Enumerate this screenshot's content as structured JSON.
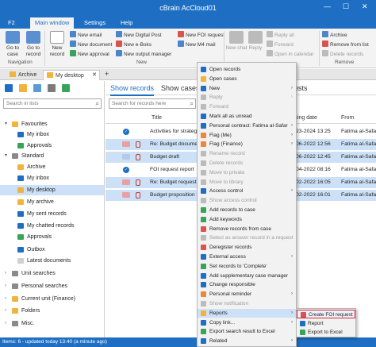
{
  "window": {
    "title": "cBrain AcCloud01",
    "minimize": "—",
    "maximize": "☐",
    "close": "✕"
  },
  "ribbon_tabs": [
    {
      "label": "F2"
    },
    {
      "label": "Main window"
    },
    {
      "label": "Settings"
    },
    {
      "label": "Help"
    }
  ],
  "ribbon": {
    "go_to_case": "Go to case",
    "go_to_record": "Go to record",
    "new_record": "New record",
    "navigation_group": "Navigation",
    "new_email": "New email",
    "new_document": "New document",
    "new_approval": "New approval",
    "new_digital_post": "New Digital Post",
    "new_eboks": "New e-Boks",
    "new_output_manager": "New output manager",
    "new_foi_request": "New FOI request",
    "new_m4_mail": "New M4 mail",
    "new_group": "New",
    "new_chat": "New chat",
    "reply": "Reply",
    "reply_all": "Reply all",
    "forward": "Forward",
    "open_in_calendar": "Open in calendar",
    "archive": "Archive",
    "remove_from_list": "Remove from list",
    "delete_records": "Delete records",
    "remove_group": "Remove"
  },
  "doc_tabs": [
    {
      "label": "Archive"
    },
    {
      "label": "My desktop"
    }
  ],
  "left": {
    "search_placeholder": "Search in lists",
    "tree": [
      {
        "label": "Favourites"
      },
      {
        "label": "My inbox"
      },
      {
        "label": "Approvals"
      },
      {
        "label": "Standard"
      },
      {
        "label": "Archive"
      },
      {
        "label": "My inbox"
      },
      {
        "label": "My desktop"
      },
      {
        "label": "My archive"
      },
      {
        "label": "My sent records"
      },
      {
        "label": "My chatted records"
      },
      {
        "label": "Approvals"
      },
      {
        "label": "Outbox"
      },
      {
        "label": "Latest documents"
      },
      {
        "label": "Unit searches"
      },
      {
        "label": "Personal searches"
      },
      {
        "label": "Current unit (Finance)"
      },
      {
        "label": "Folders"
      },
      {
        "label": "Misc."
      }
    ]
  },
  "main": {
    "view_tabs": [
      {
        "label": "Show records"
      },
      {
        "label": "Show cases"
      },
      {
        "label": "ests"
      }
    ],
    "search_placeholder": "Search for records here",
    "columns": {
      "title": "Title",
      "date": "ting date",
      "from": "From"
    },
    "rows": [
      {
        "title": "Activities for strategy",
        "date": "23-2024 13:25",
        "from": "Fatima al-Safar"
      },
      {
        "title": "Re: Budget document",
        "date": "06-2022 12:56",
        "from": "Fatima al-Safar"
      },
      {
        "title": "Budget draft",
        "date": "06-2022 12:45",
        "from": "Fatima al-Safar"
      },
      {
        "title": "FOI request report",
        "date": "04-2022 08:16",
        "from": "Fatima al-Safar"
      },
      {
        "title": "Re: Budget request",
        "date": "02-2022 16:05",
        "from": "Fatima al-Safar"
      },
      {
        "title": "Budget proposition fo",
        "date": "02-2022 16:01",
        "from": "Fatima al-Safar"
      }
    ]
  },
  "context_menu": [
    {
      "label": "Open records",
      "sub": ""
    },
    {
      "label": "Open cases",
      "sub": ""
    },
    {
      "label": "New",
      "sub": "›"
    },
    {
      "label": "Reply",
      "sub": "›"
    },
    {
      "label": "Forward",
      "sub": ""
    },
    {
      "label": "Mark all as unread",
      "sub": ""
    },
    {
      "label": "Personal contract: Fatima al-Safar",
      "sub": "›"
    },
    {
      "label": "Flag (Me)",
      "sub": "›"
    },
    {
      "label": "Flag (Finance)",
      "sub": "›"
    },
    {
      "label": "Rename record",
      "sub": ""
    },
    {
      "label": "Delete records",
      "sub": ""
    },
    {
      "label": "Move to private",
      "sub": ""
    },
    {
      "label": "Move to library",
      "sub": ""
    },
    {
      "label": "Access control",
      "sub": "›"
    },
    {
      "label": "Show access control",
      "sub": ""
    },
    {
      "label": "Add records to case",
      "sub": ""
    },
    {
      "label": "Add keywords",
      "sub": ""
    },
    {
      "label": "Remove records from case",
      "sub": ""
    },
    {
      "label": "Select as answer record in a request",
      "sub": ""
    },
    {
      "label": "Deregister records",
      "sub": ""
    },
    {
      "label": "External access",
      "sub": "›"
    },
    {
      "label": "Set records to 'Complete'",
      "sub": ""
    },
    {
      "label": "Add supplementary case manager",
      "sub": ""
    },
    {
      "label": "Change responsible",
      "sub": ""
    },
    {
      "label": "Personal reminder",
      "sub": "›"
    },
    {
      "label": "Show notification",
      "sub": ""
    },
    {
      "label": "Reports",
      "sub": "›"
    },
    {
      "label": "Copy link...",
      "sub": "›"
    },
    {
      "label": "Export search result to Excel",
      "sub": ""
    },
    {
      "label": "Related",
      "sub": "›"
    }
  ],
  "reports_submenu": [
    {
      "label": "Create FOI request"
    },
    {
      "label": "Report"
    },
    {
      "label": "Export to Excel"
    }
  ],
  "status": {
    "text": "Items: 6 - updated today 13:40 (a minute ago)"
  },
  "colors": {
    "brand": "#1e6fc4",
    "selection": "#cce1f7",
    "highlight_border": "#e0202a"
  }
}
